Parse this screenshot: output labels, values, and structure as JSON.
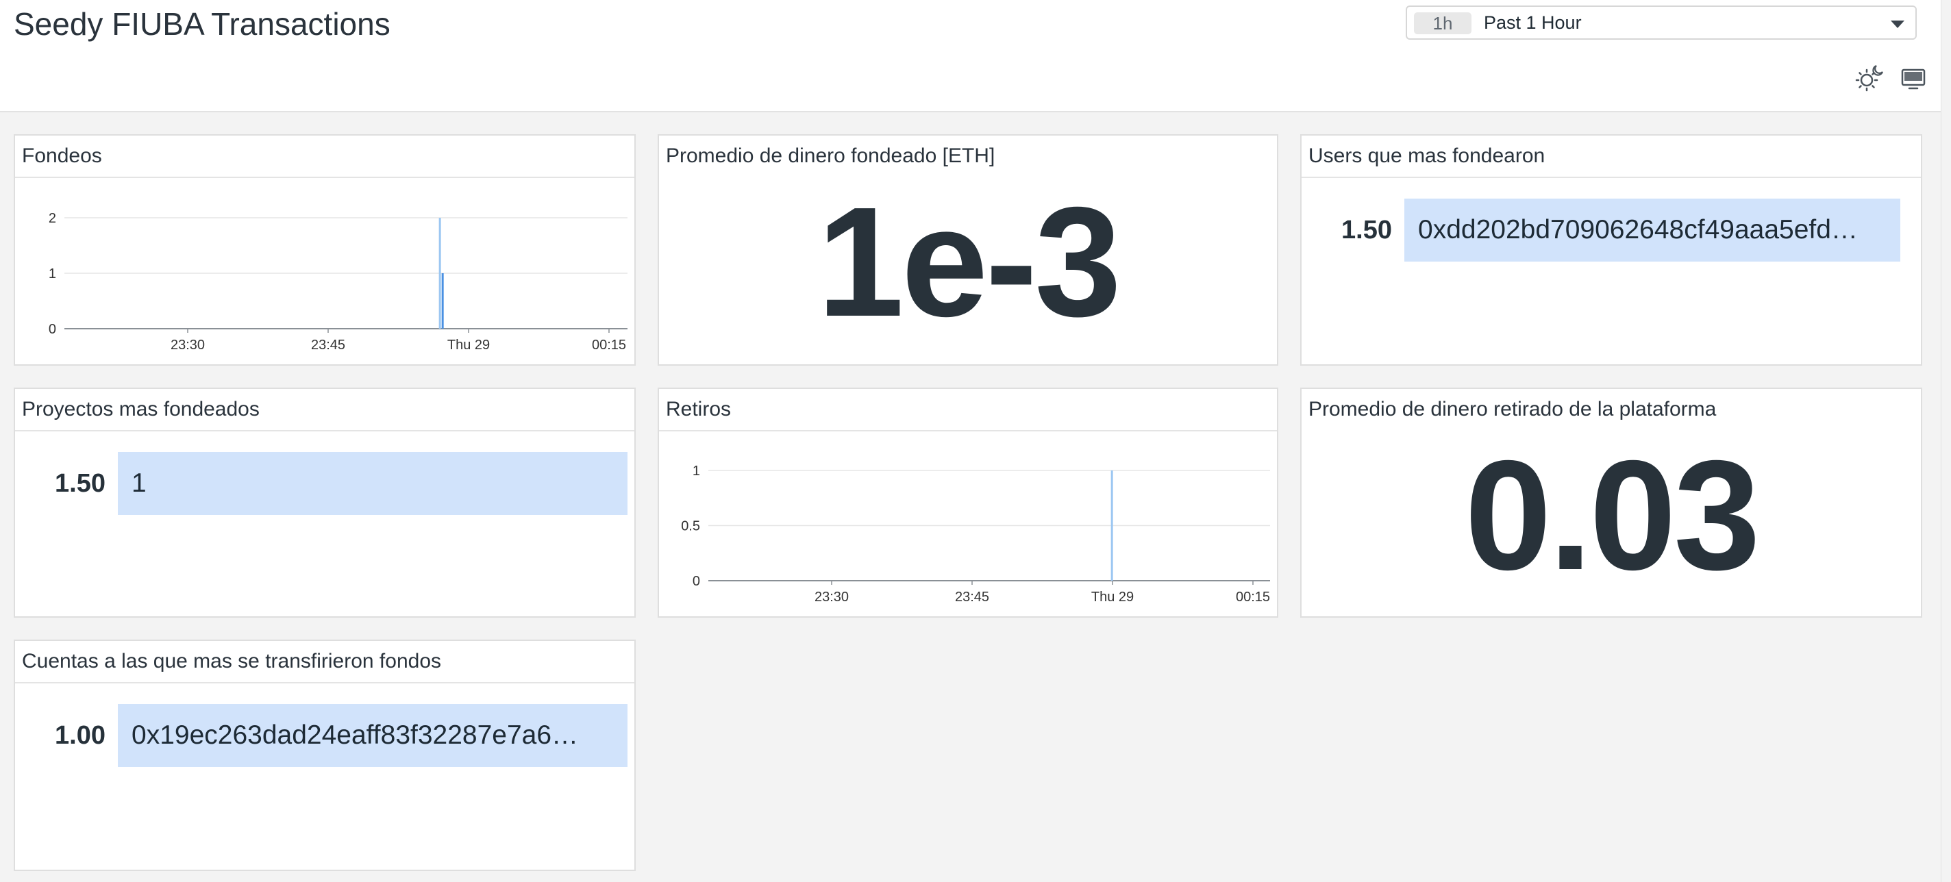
{
  "dashboard": {
    "title": "Seedy FIUBA Transactions",
    "timepicker": {
      "badge": "1h",
      "label": "Past 1 Hour"
    },
    "icons": [
      "theme-toggle-icon",
      "tv-mode-icon"
    ]
  },
  "panels": {
    "fondeos": {
      "title": "Fondeos"
    },
    "promedio_fondeado": {
      "title": "Promedio de dinero fondeado [ETH]",
      "value": "1e-3"
    },
    "users_fondearon": {
      "title": "Users que mas fondearon",
      "rows": [
        {
          "value": "1.50",
          "label": "0xdd202bd709062648cf49aaa5efd…"
        }
      ]
    },
    "proyectos_fondeados": {
      "title": "Proyectos mas fondeados",
      "rows": [
        {
          "value": "1.50",
          "label": "1"
        }
      ]
    },
    "retiros": {
      "title": "Retiros"
    },
    "promedio_retirado": {
      "title": "Promedio de dinero retirado de la plataforma",
      "value": "0.03"
    },
    "cuentas_transfirieron": {
      "title": "Cuentas a las que mas se transfirieron fondos",
      "rows": [
        {
          "value": "1.00",
          "label": "0x19ec263dad24eaff83f32287e7a6…"
        }
      ]
    }
  },
  "chart_data": [
    {
      "type": "bar",
      "panel": "Fondeos",
      "x_ticks": [
        "23:30",
        "23:45",
        "Thu 29",
        "00:15"
      ],
      "y_ticks": [
        "0",
        "1",
        "2"
      ],
      "ylim": [
        0,
        2
      ],
      "bar_color": "#4a90e2",
      "series": [
        {
          "values": [
            {
              "time": "Thu 29 00:00",
              "value": 2
            },
            {
              "time": "Thu 29 00:00",
              "value": 1
            }
          ]
        }
      ]
    },
    {
      "type": "bar",
      "panel": "Retiros",
      "x_ticks": [
        "23:30",
        "23:45",
        "Thu 29",
        "00:15"
      ],
      "y_ticks": [
        "0",
        "0.5",
        "1"
      ],
      "ylim": [
        0,
        1
      ],
      "bar_color": "#4a90e2",
      "series": [
        {
          "values": [
            {
              "time": "Thu 29 00:03",
              "value": 1
            }
          ]
        }
      ]
    }
  ]
}
